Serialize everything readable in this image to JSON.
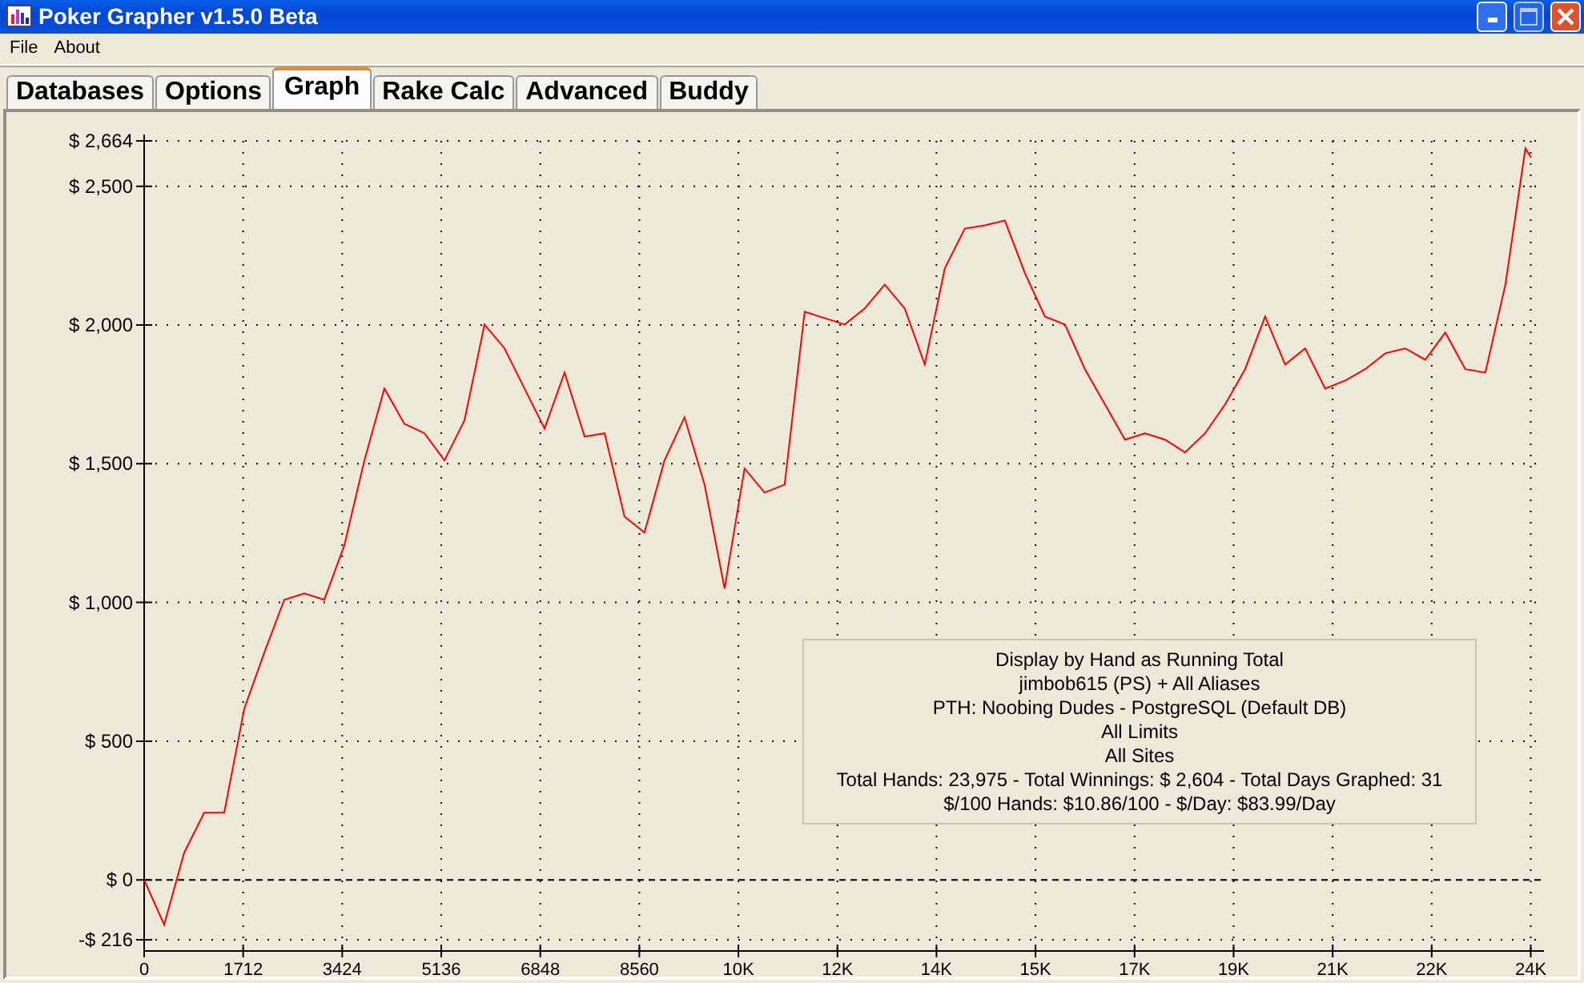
{
  "window": {
    "title": "Poker Grapher v1.5.0 Beta"
  },
  "menu": [
    "File",
    "About"
  ],
  "tabs": [
    {
      "label": "Databases",
      "selected": false
    },
    {
      "label": "Options",
      "selected": false
    },
    {
      "label": "Graph",
      "selected": true
    },
    {
      "label": "Rake Calc",
      "selected": false
    },
    {
      "label": "Advanced",
      "selected": false
    },
    {
      "label": "Buddy",
      "selected": false
    }
  ],
  "graph": {
    "chart_data": {
      "type": "line",
      "x": [
        0,
        346,
        692,
        1038,
        1384,
        1730,
        2076,
        2422,
        2768,
        3114,
        3460,
        3806,
        4152,
        4498,
        4844,
        5190,
        5536,
        5882,
        6228,
        6574,
        6920,
        7266,
        7612,
        7958,
        8304,
        8650,
        8996,
        9342,
        9688,
        10034,
        10380,
        10726,
        11072,
        11418,
        11764,
        12110,
        12456,
        12802,
        13148,
        13494,
        13840,
        14186,
        14532,
        14878,
        15224,
        15570,
        15916,
        16262,
        16608,
        16954,
        17300,
        17646,
        17992,
        18338,
        18684,
        19030,
        19376,
        19722,
        20068,
        20414,
        20760,
        21106,
        21452,
        21798,
        22144,
        22490,
        22836,
        23182,
        23528,
        23874,
        23975
      ],
      "series": [
        {
          "color": "#ff0000",
          "values": [
            0,
            -162,
            98,
            242,
            242,
            617,
            819,
            1010,
            1033,
            1010,
            1206,
            1512,
            1771,
            1644,
            1610,
            1512,
            1656,
            2002,
            1916,
            1771,
            1627,
            1829,
            1598,
            1610,
            1310,
            1252,
            1512,
            1668,
            1425,
            1050,
            1483,
            1396,
            1425,
            2048,
            2025,
            2002,
            2060,
            2146,
            2060,
            1858,
            2204,
            2348,
            2360,
            2377,
            2187,
            2031,
            2002,
            1841,
            1714,
            1587,
            1610,
            1587,
            1541,
            1610,
            1714,
            1841,
            2031,
            1858,
            1916,
            1771,
            1800,
            1841,
            1898,
            1916,
            1875,
            1973,
            1841,
            1829,
            2146,
            2637,
            2604
          ]
        }
      ],
      "xlim": [
        0,
        23975
      ],
      "ylim": [
        -216,
        2664
      ],
      "grid": true,
      "xticks": [
        0,
        1712,
        3424,
        5136,
        6848,
        8560,
        {
          "value": 10272,
          "label": "10K"
        },
        {
          "value": 11984,
          "label": "12K"
        },
        {
          "value": 13696,
          "label": "14K"
        },
        {
          "value": 15408,
          "label": "15K"
        },
        {
          "value": 17120,
          "label": "17K"
        },
        {
          "value": 18832,
          "label": "19K"
        },
        {
          "value": 20544,
          "label": "21K"
        },
        {
          "value": 22256,
          "label": "22K"
        },
        {
          "value": 23968,
          "label": "24K"
        }
      ],
      "yticks": [
        {
          "value": -216,
          "label": "-$ 216"
        },
        {
          "value": 0,
          "label": "$ 0"
        },
        {
          "value": 500,
          "label": "$ 500"
        },
        {
          "value": 1000,
          "label": "$ 1,000"
        },
        {
          "value": 1500,
          "label": "$ 1,500"
        },
        {
          "value": 2000,
          "label": "$ 2,000"
        },
        {
          "value": 2500,
          "label": "$ 2,500"
        },
        {
          "value": 2664,
          "label": "$ 2,664"
        }
      ]
    },
    "info": [
      "Display by Hand as Running Total",
      "jimbob615 (PS) + All Aliases",
      "PTH: Noobing Dudes - PostgreSQL (Default DB)",
      "All Limits",
      "All Sites",
      "Total Hands: 23,975 - Total Winnings: $ 2,604 - Total Days Graphed: 31",
      "$/100 Hands: $10.86/100 - $/Day: $83.99/Day"
    ]
  }
}
